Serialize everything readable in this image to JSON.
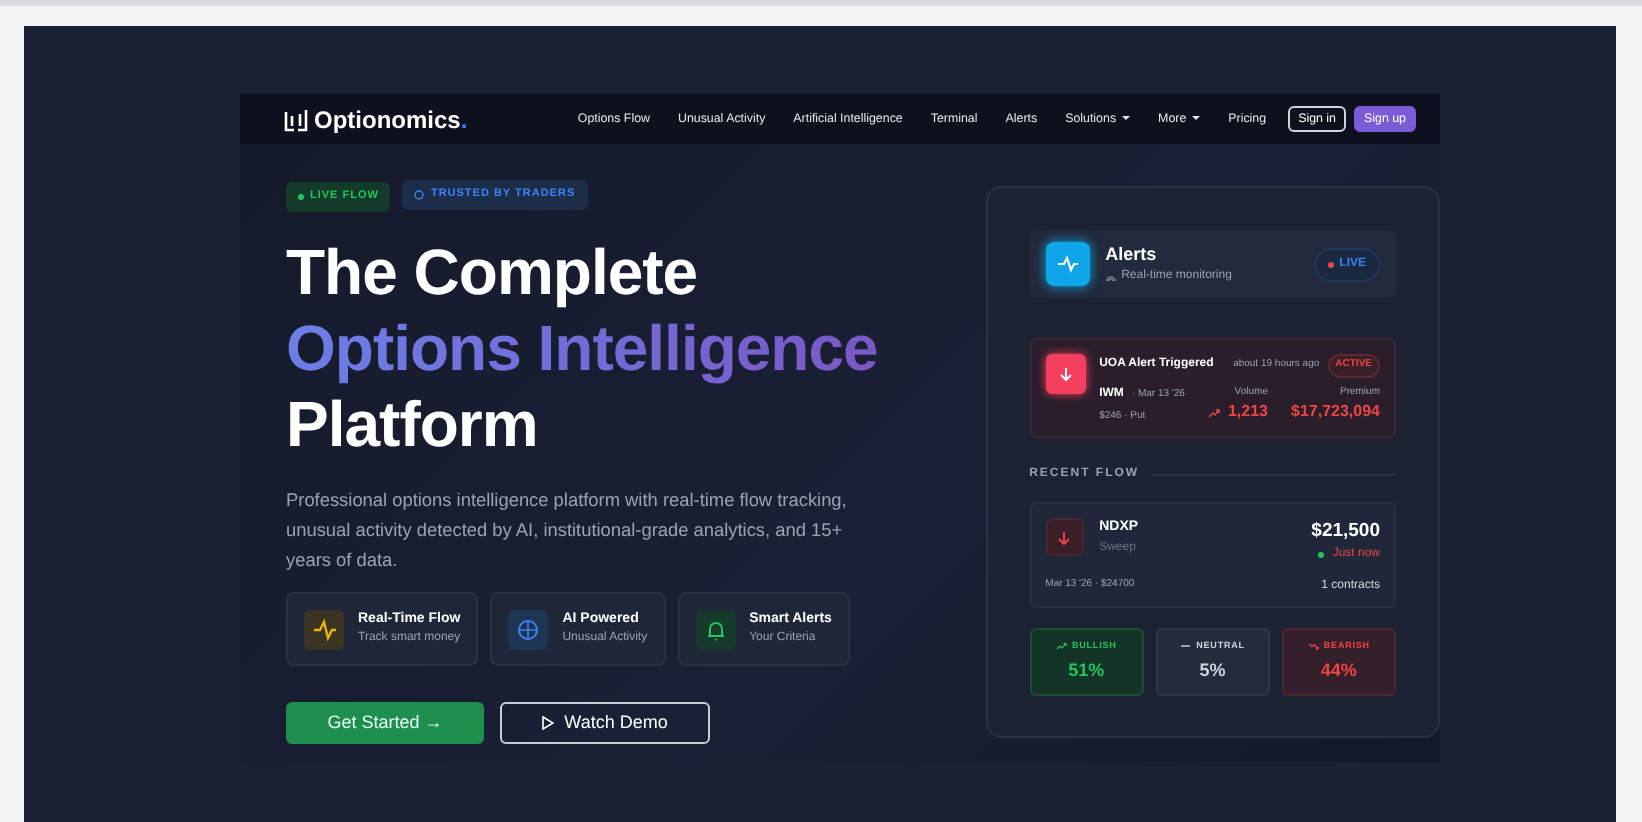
{
  "navbar": {
    "logo": "Optionomics",
    "logo_dot": ".",
    "links": [
      {
        "label": "Options Flow",
        "dropdown": false
      },
      {
        "label": "Unusual Activity",
        "dropdown": false
      },
      {
        "label": "Artificial Intelligence",
        "dropdown": false
      },
      {
        "label": "Terminal",
        "dropdown": false
      },
      {
        "label": "Alerts",
        "dropdown": false
      },
      {
        "label": "Solutions",
        "dropdown": true
      },
      {
        "label": "More",
        "dropdown": true
      },
      {
        "label": "Pricing",
        "dropdown": false
      }
    ],
    "sign_in": "Sign in",
    "sign_up": "Sign up"
  },
  "hero": {
    "badges": [
      {
        "label": "LIVE FLOW",
        "kind": "live"
      },
      {
        "label": "TRUSTED BY TRADERS",
        "kind": "trusted"
      }
    ],
    "headline": [
      {
        "text": "The Complete",
        "kind": "plain"
      },
      {
        "text": "Options Intelligence",
        "kind": "gradient"
      },
      {
        "text": "Platform",
        "kind": "plain"
      }
    ],
    "description": "Professional options intelligence platform with real-time flow tracking, unusual activity detected by AI, institutional-grade analytics, and 15+ years of data.",
    "features": [
      {
        "title": "Real-Time Flow",
        "subtitle": "Track smart money",
        "kind": "flow"
      },
      {
        "title": "AI Powered",
        "subtitle": "Unusual Activity",
        "kind": "ai"
      },
      {
        "title": "Smart Alerts",
        "subtitle": "Your Criteria",
        "kind": "alerts"
      }
    ],
    "buttons": [
      {
        "label": "Get Started →",
        "kind": "primary"
      },
      {
        "label": "Watch Demo",
        "kind": "outline"
      }
    ]
  },
  "panel": {
    "header": {
      "title": "Alerts",
      "subtitle": "Real-time monitoring",
      "status": "LIVE"
    },
    "alert": {
      "title": "UOA Alert Triggered",
      "time": "about 19 hours ago",
      "status": "ACTIVE",
      "symbol": "IWM",
      "date": "· Mar 13 '26",
      "detail": "$246 · Put",
      "volume_label": "Volume",
      "volume": "1,213",
      "premium_label": "Premium",
      "premium": "$17,723,094"
    },
    "recent_flow_label": "RECENT FLOW",
    "flow": {
      "symbol": "NDXP",
      "type": "Sweep",
      "amount": "$21,500",
      "time": "Just now",
      "date": "Mar 13 '26 · $24700",
      "contracts": "1 contracts"
    },
    "sentiment": [
      {
        "label": "BULLISH",
        "value": "51%",
        "kind": "bullish"
      },
      {
        "label": "NEUTRAL",
        "value": "5%",
        "kind": "neutral"
      },
      {
        "label": "BEARISH",
        "value": "44%",
        "kind": "bearish"
      }
    ]
  }
}
